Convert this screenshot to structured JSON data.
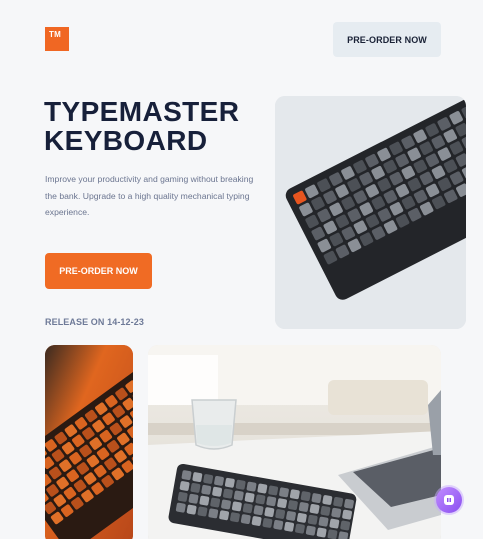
{
  "brand": {
    "logo_text": "TM"
  },
  "header": {
    "cta_label": "PRE-ORDER NOW"
  },
  "hero": {
    "title_line1": "TYPEMASTER",
    "title_line2": "KEYBOARD",
    "description": "Improve your productivity and gaming without breaking the bank. Upgrade to a high quality mechanical typing experience.",
    "cta_label": "PRE-ORDER NOW",
    "release": "RELEASE ON 14-12-23"
  },
  "colors": {
    "accent": "#f06b24",
    "heading": "#17203a",
    "muted": "#6b7590",
    "header_button": "#e6ecf1"
  },
  "icons": {
    "chat": "chat-bubble-icon"
  }
}
